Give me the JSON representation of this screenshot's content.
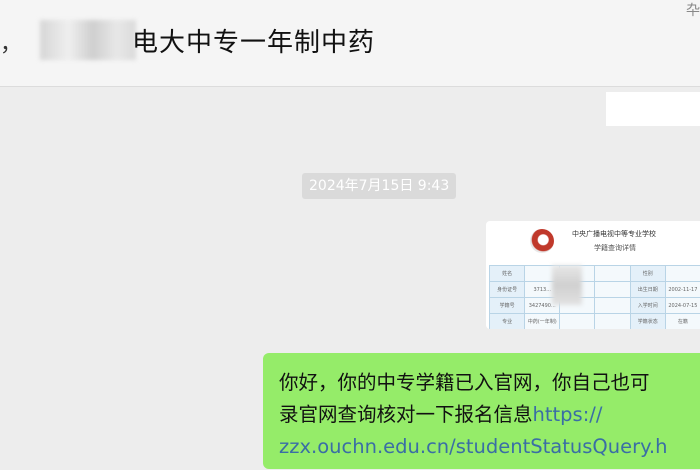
{
  "header": {
    "title_lead": "，",
    "title": "电大中专一年制中药",
    "corner_glyph": "卆"
  },
  "timestamp": "2024年7月15日 9:43",
  "image_message": {
    "doc_title_line1": "中央广播电视中等专业学校",
    "doc_title_line2": "学籍查询详情",
    "rows": [
      [
        "姓名",
        "",
        "",
        "",
        "性别",
        ""
      ],
      [
        "身份证号",
        "3713...",
        "",
        "",
        "出生日期",
        "2002-11-17"
      ],
      [
        "学籍号",
        "3427490...",
        "",
        "",
        "入学时间",
        "2024-07-15"
      ],
      [
        "专业",
        "中药(一年制)",
        "",
        "",
        "学籍状态",
        "在籍"
      ]
    ]
  },
  "text_message": {
    "line1": "你好，你的中专学籍已入官网，你自己也可",
    "line2_text": "录官网查询核对一下报名信息",
    "line2_link": "https://",
    "line3_link": "zzx.ouchn.edu.cn/studentStatusQuery.h"
  }
}
